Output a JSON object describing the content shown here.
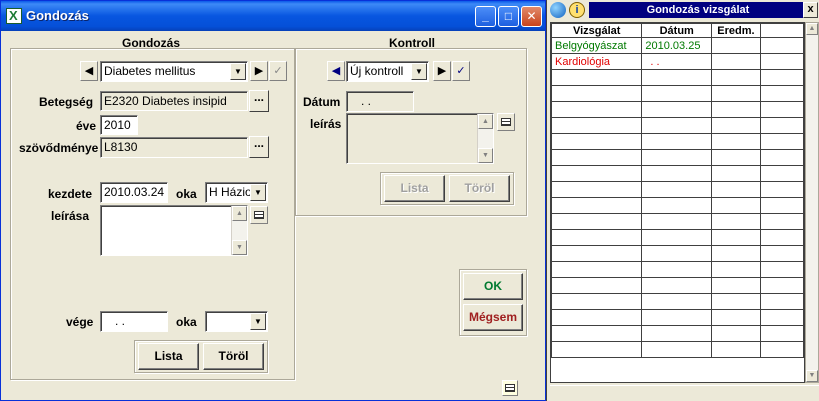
{
  "window": {
    "title": "Gondozás",
    "app_icon": "X",
    "buttons": [
      "_",
      "□",
      "✕"
    ]
  },
  "gondozas": {
    "heading": "Gondozás",
    "diagnosis_select": "Diabetes mellitus",
    "betegseg_label": "Betegség",
    "betegseg_value": "E2320 Diabetes insipid",
    "eve_label": "éve",
    "eve_value": "2010",
    "szovodmenye_label": "szövődménye",
    "szovodmenye_value": "L8130",
    "kezdete_label": "kezdete",
    "kezdete_value": "2010.03.24",
    "oka_label": "oka",
    "oka_value": "H Házio",
    "leirasa_label": "leírása",
    "leirasa_value": "",
    "vege_label": "vége",
    "vege_value": ". .",
    "vege_oka_label": "oka",
    "vege_oka_value": "",
    "lista_button": "Lista",
    "torol_button": "Töröl"
  },
  "kontroll": {
    "heading": "Kontroll",
    "select_value": "Új kontroll",
    "datum_label": "Dátum",
    "datum_value": ". .",
    "leiras_label": "leírás",
    "lista_button": "Lista",
    "torol_button": "Töröl"
  },
  "dialog": {
    "ok_button": "OK",
    "cancel_button": "Mégsem"
  },
  "vizsgalat": {
    "title": "Gondozás vizsgálat",
    "close": "x",
    "columns": [
      "Vizsgálat",
      "Dátum",
      "Eredm.",
      ""
    ],
    "rows": [
      {
        "vizsgalat": "Belgyógyászat",
        "datum": "2010.03.25",
        "eredmeny": "",
        "extra": "",
        "color": "#007a00"
      },
      {
        "vizsgalat": "Kardiológia",
        "datum": ". .",
        "eredmeny": "",
        "extra": "",
        "color": "#e00000"
      }
    ],
    "empty_rows": 18
  },
  "colors": {
    "ok_text": "#007a30",
    "cancel_text": "#a02020",
    "titlebar": "#0a5ae8"
  }
}
